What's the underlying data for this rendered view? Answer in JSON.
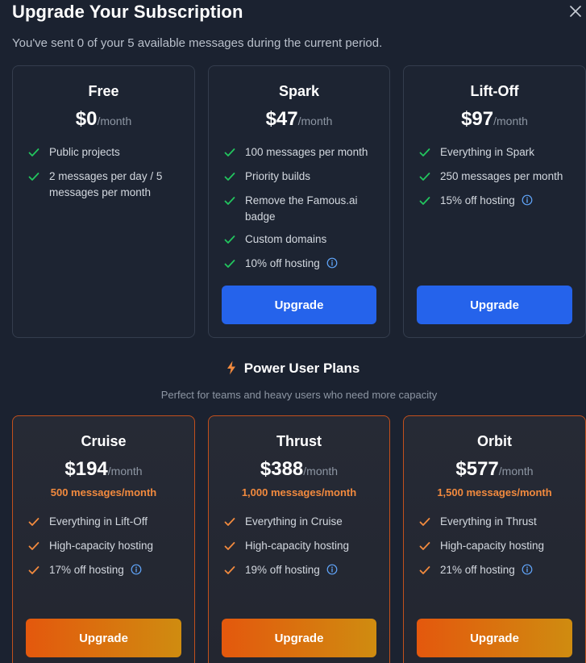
{
  "dialog": {
    "title": "Upgrade Your Subscription",
    "subtitle": "You've sent 0 of your 5 available messages during the current period.",
    "close_icon": "close-icon"
  },
  "standard_plans": [
    {
      "name": "Free",
      "price": "$0",
      "per": "/month",
      "features": [
        "Public projects",
        "2 messages per day / 5 messages per month"
      ]
    },
    {
      "name": "Spark",
      "price": "$47",
      "per": "/month",
      "features": [
        "100 messages per month",
        "Priority builds",
        "Remove the Famous.ai badge",
        "Custom domains",
        "10% off hosting"
      ],
      "button": "Upgrade"
    },
    {
      "name": "Lift-Off",
      "price": "$97",
      "per": "/month",
      "features": [
        "Everything in Spark",
        "250 messages per month",
        "15% off hosting"
      ],
      "button": "Upgrade"
    }
  ],
  "power_section": {
    "title": "Power User Plans",
    "subtitle": "Perfect for teams and heavy users who need more capacity",
    "icon": "lightning-bolt-icon"
  },
  "power_plans": [
    {
      "name": "Cruise",
      "price": "$194",
      "per": "/month",
      "messages": "500 messages/month",
      "features": [
        "Everything in Lift-Off",
        "High-capacity hosting",
        "17% off hosting"
      ],
      "button": "Upgrade"
    },
    {
      "name": "Thrust",
      "price": "$388",
      "per": "/month",
      "messages": "1,000 messages/month",
      "features": [
        "Everything in Cruise",
        "High-capacity hosting",
        "19% off hosting"
      ],
      "button": "Upgrade"
    },
    {
      "name": "Orbit",
      "price": "$577",
      "per": "/month",
      "messages": "1,500 messages/month",
      "features": [
        "Everything in Thrust",
        "High-capacity hosting",
        "21% off hosting"
      ],
      "button": "Upgrade"
    }
  ],
  "colors": {
    "background": "#1b2230",
    "check_green": "#22c55e",
    "check_orange": "#f28a3e",
    "button_blue": "#2563eb",
    "info_blue": "#60a5fa"
  }
}
